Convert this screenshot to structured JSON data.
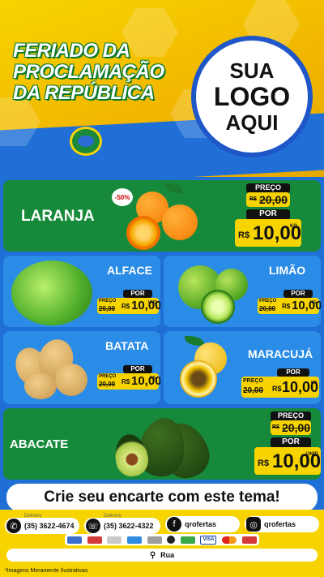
{
  "header": {
    "title_lines": [
      "FERIADO DA",
      "PROCLAMAÇÃO",
      "DA REPÚBLICA"
    ],
    "logo_lines": [
      "SUA",
      "LOGO",
      "AQUI"
    ]
  },
  "products": {
    "laranja": {
      "name": "LARANJA",
      "discount": "-50%",
      "preco_label": "PREÇO",
      "old_price": "20,00",
      "por_label": "POR",
      "currency": "R$",
      "price": "10,00",
      "unit": "KG"
    },
    "alface": {
      "name": "ALFACE",
      "preco_label": "PREÇO",
      "old_price": "20,00",
      "por_label": "POR",
      "currency": "R$",
      "price": "10,00",
      "unit": "UND"
    },
    "limao": {
      "name": "LIMÃO",
      "preco_label": "PREÇO",
      "old_price": "20,00",
      "por_label": "POR",
      "currency": "R$",
      "price": "10,00",
      "unit": "KG"
    },
    "batata": {
      "name": "BATATA",
      "preco_label": "PREÇO",
      "old_price": "20,00",
      "por_label": "POR",
      "currency": "R$",
      "price": "10,00",
      "unit": "KG"
    },
    "maracuja": {
      "name": "MARACUJÁ",
      "preco_label": "PREÇO",
      "old_price": "20,00",
      "por_label": "POR",
      "currency": "R$",
      "price": "10,00",
      "unit": "KG"
    },
    "abacate": {
      "name": "ABACATE",
      "preco_label": "PREÇO",
      "old_price": "20,00",
      "por_label": "POR",
      "currency": "R$",
      "price": "10,00",
      "unit": "UNID"
    }
  },
  "banner": {
    "text": "Crie seu encarte com este tema!"
  },
  "footer": {
    "delivery_label": "Delivery",
    "phone1": "(35) 3622-4674",
    "phone2": "(35) 3622-4322",
    "facebook": "qrofertas",
    "instagram": "qrofertas",
    "address": "Rua",
    "disclaimer": "*Imagens Meramente Ilustrativas",
    "payment_labels": [
      "VISA"
    ]
  },
  "colors": {
    "green": "#168a3a",
    "blue": "#2a8ce6",
    "yellow": "#f7d400"
  }
}
